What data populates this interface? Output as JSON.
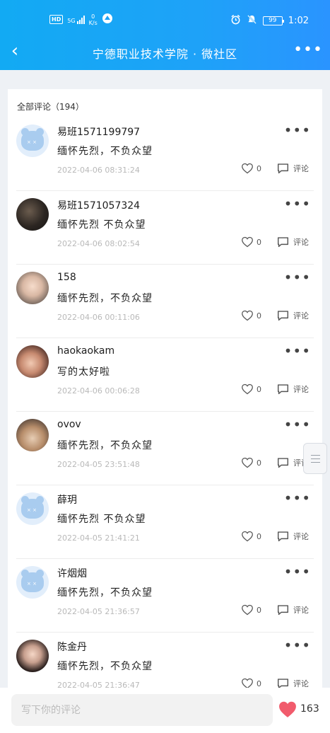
{
  "status_bar": {
    "hd": "HD",
    "network": "5G",
    "speed_value": "0",
    "speed_unit": "K/s",
    "battery": "99",
    "time": "1:02"
  },
  "nav": {
    "title": "宁德职业技术学院 · 微社区"
  },
  "comments_header": {
    "title": "全部评论（194）"
  },
  "comments": [
    {
      "name": "易班1571199797",
      "content": "缅怀先烈，不负众望",
      "time": "2022-04-06 08:31:24",
      "likes": "0",
      "comment_label": "评论",
      "avatar": "default"
    },
    {
      "name": "易班1571057324",
      "content": "缅怀先烈 不负众望",
      "time": "2022-04-06 08:02:54",
      "likes": "0",
      "comment_label": "评论",
      "avatar": "photo"
    },
    {
      "name": "158",
      "content": "缅怀先烈，不负众望",
      "time": "2022-04-06 00:11:06",
      "likes": "0",
      "comment_label": "评论",
      "avatar": "photo"
    },
    {
      "name": "haokaokam",
      "content": "写的太好啦",
      "time": "2022-04-06 00:06:28",
      "likes": "0",
      "comment_label": "评论",
      "avatar": "photo"
    },
    {
      "name": "ovov",
      "content": "缅怀先烈，不负众望",
      "time": "2022-04-05 23:51:48",
      "likes": "0",
      "comment_label": "评论",
      "avatar": "photo"
    },
    {
      "name": "薛玥",
      "content": "缅怀先烈 不负众望",
      "time": "2022-04-05 21:41:21",
      "likes": "0",
      "comment_label": "评论",
      "avatar": "default"
    },
    {
      "name": "许烟烟",
      "content": "缅怀先烈，不负众望",
      "time": "2022-04-05 21:36:57",
      "likes": "0",
      "comment_label": "评论",
      "avatar": "default"
    },
    {
      "name": "陈金丹",
      "content": "缅怀先烈，不负众望",
      "time": "2022-04-05 21:36:47",
      "likes": "0",
      "comment_label": "评论",
      "avatar": "photo"
    }
  ],
  "bottom_bar": {
    "placeholder": "写下你的评论",
    "like_count": "163"
  },
  "colors": {
    "header_start": "#12aaf3",
    "header_end": "#2a94ff",
    "like_heart": "#f15b6c"
  }
}
